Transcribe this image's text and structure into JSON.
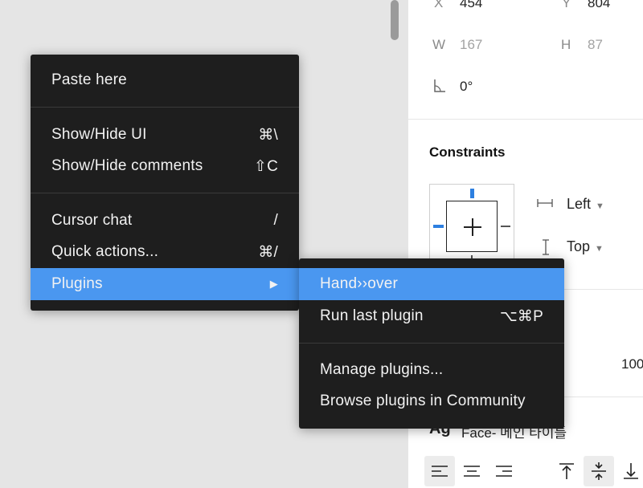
{
  "panel": {
    "position": {
      "x_label": "X",
      "x_value": "454",
      "y_label": "Y",
      "y_value": "804"
    },
    "size": {
      "w_label": "W",
      "w_value": "167",
      "h_label": "H",
      "h_value": "87"
    },
    "rotation": {
      "value": "0°"
    },
    "constraints": {
      "title": "Constraints",
      "horizontal": "Left",
      "vertical": "Top"
    },
    "partial_value": "100",
    "text": {
      "ag_label": "Ag",
      "font_name": "Face- 메인 타이틀"
    }
  },
  "context_menu": {
    "items": [
      {
        "label": "Paste here",
        "shortcut": ""
      },
      {
        "label": "Show/Hide UI",
        "shortcut": "⌘\\"
      },
      {
        "label": "Show/Hide comments",
        "shortcut": "⇧C"
      },
      {
        "label": "Cursor chat",
        "shortcut": "/"
      },
      {
        "label": "Quick actions...",
        "shortcut": "⌘/"
      },
      {
        "label": "Plugins",
        "shortcut": "▶"
      }
    ]
  },
  "plugins_submenu": {
    "items": [
      {
        "label": "Hand››over",
        "shortcut": ""
      },
      {
        "label": "Run last plugin",
        "shortcut": "⌥⌘P"
      },
      {
        "label": "Manage plugins...",
        "shortcut": ""
      },
      {
        "label": "Browse plugins in Community",
        "shortcut": ""
      }
    ]
  },
  "colors": {
    "menu_bg": "#1e1e1e",
    "highlight": "#4a97f0",
    "constraint_accent": "#2d7fe0"
  }
}
